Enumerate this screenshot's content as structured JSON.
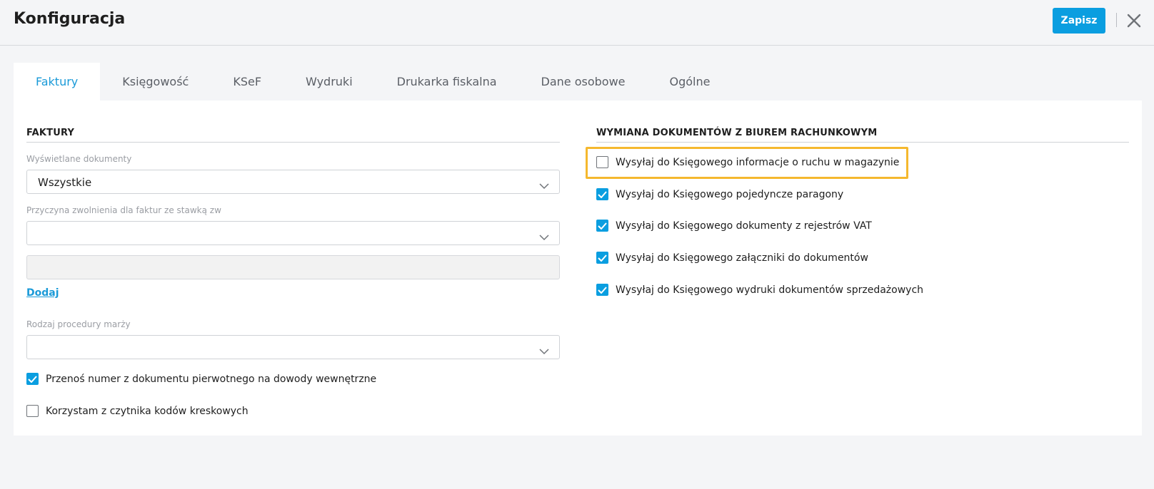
{
  "header": {
    "title": "Konfiguracja",
    "save_label": "Zapisz",
    "close_icon": "close-icon"
  },
  "tabs": [
    {
      "label": "Faktury",
      "active": true
    },
    {
      "label": "Księgowość",
      "active": false
    },
    {
      "label": "KSeF",
      "active": false
    },
    {
      "label": "Wydruki",
      "active": false
    },
    {
      "label": "Drukarka fiskalna",
      "active": false
    },
    {
      "label": "Dane osobowe",
      "active": false
    },
    {
      "label": "Ogólne",
      "active": false
    }
  ],
  "left": {
    "title": "FAKTURY",
    "documents_label": "Wyświetlane dokumenty",
    "documents_value": "Wszystkie",
    "exemption_label": "Przyczyna zwolnienia dla faktur ze stawką zw",
    "exemption_value": "",
    "add_link": "Dodaj",
    "margin_label": "Rodzaj procedury marży",
    "margin_value": "",
    "checkboxes": [
      {
        "label": "Przenoś numer z dokumentu pierwotnego na dowody wewnętrzne",
        "checked": true
      },
      {
        "label": "Korzystam z czytnika kodów kreskowych",
        "checked": false
      }
    ]
  },
  "right": {
    "title": "WYMIANA DOKUMENTÓW Z BIUREM RACHUNKOWYM",
    "checkboxes": [
      {
        "label": "Wysyłaj do Księgowego informacje o ruchu w magazynie",
        "checked": false
      },
      {
        "label": "Wysyłaj do Księgowego pojedyncze paragony",
        "checked": true
      },
      {
        "label": "Wysyłaj do Księgowego dokumenty z rejestrów VAT",
        "checked": true
      },
      {
        "label": "Wysyłaj do Księgowego załączniki do dokumentów",
        "checked": true
      },
      {
        "label": "Wysyłaj do Księgowego wydruki dokumentów sprzedażowych",
        "checked": true
      }
    ]
  },
  "colors": {
    "accent": "#0a9ee0",
    "highlight": "#f5b82e"
  }
}
